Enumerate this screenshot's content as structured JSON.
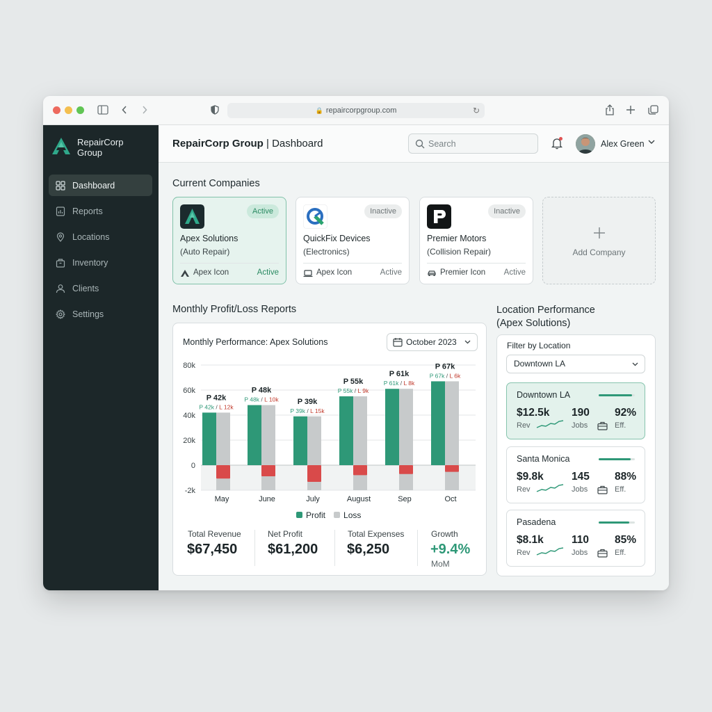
{
  "browser": {
    "url": "repaircorpgroup.com"
  },
  "brand": {
    "line1": "RepairCorp",
    "line2": "Group"
  },
  "sidebar": {
    "items": [
      {
        "label": "Dashboard",
        "icon": "grid-icon",
        "active": true
      },
      {
        "label": "Reports",
        "icon": "report-icon"
      },
      {
        "label": "Locations",
        "icon": "location-pin-icon"
      },
      {
        "label": "Inventory",
        "icon": "box-icon"
      },
      {
        "label": "Clients",
        "icon": "user-icon"
      },
      {
        "label": "Settings",
        "icon": "gear-icon"
      }
    ]
  },
  "header": {
    "title_bold": "RepairCorp Group",
    "title_rest": " | Dashboard",
    "search_placeholder": "Search",
    "user_name": "Alex Green"
  },
  "companies": {
    "title": "Current Companies",
    "cards": [
      {
        "name": "Apex Solutions",
        "type": "(Auto Repair)",
        "badge": "Active",
        "footer_label": "Apex Icon",
        "footer_status": "Active"
      },
      {
        "name": "QuickFix Devices",
        "type": "(Electronics)",
        "badge": "Inactive",
        "footer_label": "Apex Icon",
        "footer_status": "Active"
      },
      {
        "name": "Premier Motors",
        "type": "(Collision Repair)",
        "badge": "Inactive",
        "footer_label": "Premier Icon",
        "footer_status": "Active"
      }
    ],
    "add_label": "Add Company"
  },
  "reports": {
    "title": "Monthly Profit/Loss Reports",
    "chart_title": "Monthly Performance: Apex Solutions",
    "month": "October 2023",
    "stats": [
      {
        "label": "Total Revenue",
        "value": "$67,450"
      },
      {
        "label": "Net Profit",
        "value": "$61,200"
      },
      {
        "label": "Total Expenses",
        "value": "$6,250"
      },
      {
        "label": "Growth",
        "value": "+9.4%",
        "sub": "MoM"
      }
    ]
  },
  "chart_data": {
    "type": "bar",
    "title": "Monthly Performance: Apex Solutions",
    "categories": [
      "May",
      "June",
      "July",
      "August",
      "Sep",
      "Oct"
    ],
    "y_ticks": [
      "80k",
      "60k",
      "40k",
      "20k",
      "0",
      "-2k"
    ],
    "ylim": [
      -2000,
      80000
    ],
    "series": [
      {
        "name": "Profit",
        "color": "#2e9877",
        "values": [
          42000,
          48000,
          39000,
          55000,
          61000,
          67000
        ]
      },
      {
        "name": "Loss",
        "color": "#c7cacb",
        "values": [
          12000,
          10000,
          15000,
          9000,
          8000,
          6000
        ]
      }
    ],
    "bar_labels": [
      {
        "top": "P 42k",
        "profit": "P 42k",
        "loss": "L 12k"
      },
      {
        "top": "P 48k",
        "profit": "P 48k",
        "loss": "L 10k"
      },
      {
        "top": "P 39k",
        "profit": "P 39k",
        "loss": "L 15k"
      },
      {
        "top": "P 55k",
        "profit": "P 55k",
        "loss": "L 9k"
      },
      {
        "top": "P 61k",
        "profit": "P 61k",
        "loss": "L 8k"
      },
      {
        "top": "P 67k",
        "profit": "P 67k",
        "loss": "L 6k"
      }
    ],
    "loss_marker_color": "#d94a4a",
    "legend": [
      "Profit",
      "Loss"
    ],
    "legend_position": "bottom",
    "grid": true
  },
  "locations": {
    "title_line1": "Location Performance",
    "title_line2": "(Apex Solutions)",
    "filter_label": "Filter by Location",
    "filter_value": "Downtown LA",
    "cards": [
      {
        "name": "Downtown LA",
        "rev": "$12.5k",
        "rev_label": "Rev",
        "jobs": "190",
        "jobs_label": "Jobs",
        "eff": "92%",
        "eff_label": "Eff.",
        "efficiency": 0.92,
        "active": true
      },
      {
        "name": "Santa Monica",
        "rev": "$9.8k",
        "rev_label": "Rev",
        "jobs": "145",
        "jobs_label": "Jobs",
        "eff": "88%",
        "eff_label": "Eff.",
        "efficiency": 0.88
      },
      {
        "name": "Pasadena",
        "rev": "$8.1k",
        "rev_label": "Rev",
        "jobs": "110",
        "jobs_label": "Jobs",
        "eff": "85%",
        "eff_label": "Eff.",
        "efficiency": 0.85
      }
    ]
  },
  "colors": {
    "accent": "#2e9877",
    "sidebar": "#1c2729",
    "loss": "#d94a4a",
    "growth": "#2e9877"
  }
}
